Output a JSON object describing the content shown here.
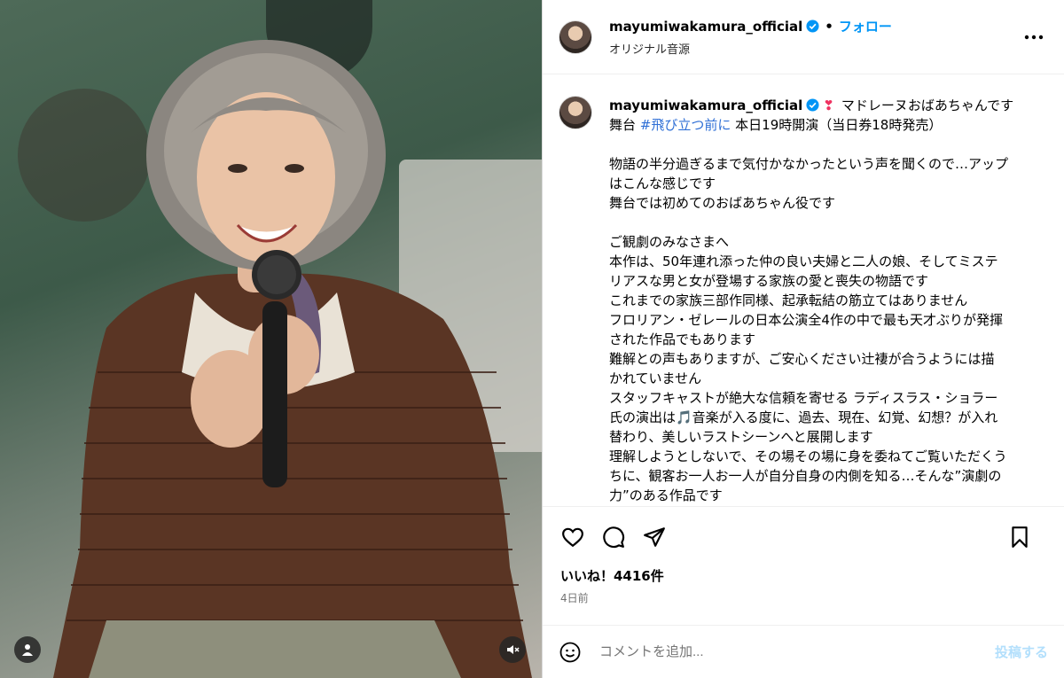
{
  "post": {
    "username": "mayumiwakamura_official",
    "separator": "•",
    "follow_label": "フォロー",
    "audio_label": "オリジナル音源",
    "more_icon": "more-horizontal-icon"
  },
  "caption": {
    "username": "mayumiwakamura_official",
    "heart": "❣",
    "line1_rest": "マドレーヌおばあちゃんです",
    "line2_prefix": "舞台",
    "hashtag": "#飛び立つ前に",
    "line2_suffix": "本日19時開演（当日券18時発売）",
    "para1": [
      "物語の半分過ぎるまで気付かなかったという声を聞くので…アップ",
      "はこんな感じです",
      "舞台では初めてのおばあちゃん役です"
    ],
    "para2": [
      "ご観劇のみなさまへ",
      "本作は、50年連れ添った仲の良い夫婦と二人の娘、そしてミステ",
      "リアスな男と女が登場する家族の愛と喪失の物語です",
      "これまでの家族三部作同様、起承転結の筋立てはありません",
      "フロリアン・ゼレールの日本公演全4作の中で最も天才ぶりが発揮",
      "された作品でもあります",
      "難解との声もありますが、ご安心ください辻褄が合うようには描",
      "かれていません",
      "スタッフキャストが絶大な信頼を寄せる ラディスラス・ショラー",
      "氏の演出は🎵音楽が入る度に、過去、現在、幻覚、幻想？が入れ",
      "替わり、美しいラストシーンへと展開します",
      "理解しようとしないで、その場その場に身を委ねてご覧いただくう",
      "ちに、観客お一人お一人が自分自身の内側を知る…そんな”演劇の",
      "力”のある作品です"
    ]
  },
  "stats": {
    "likes": "いいね！4416件",
    "time_ago": "4日前"
  },
  "comment": {
    "placeholder": "コメントを追加...",
    "post_label": "投稿する"
  },
  "colors": {
    "accent": "#0095f6",
    "verified": "#0095f6",
    "heart": "#ef3361",
    "muted": "#737373"
  }
}
